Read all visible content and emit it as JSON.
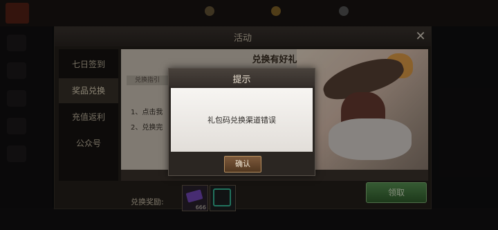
{
  "panel": {
    "title": "活动",
    "close_icon": "close-icon",
    "sidebar": [
      {
        "label": "七日签到",
        "active": false
      },
      {
        "label": "奖品兑换",
        "active": true
      },
      {
        "label": "充值返利",
        "active": false
      },
      {
        "label": "公众号",
        "active": false
      }
    ],
    "content": {
      "heading": "兑换有好礼",
      "guide_tab": "兑换指引",
      "steps": [
        "1、点击我",
        "2、兑换完"
      ]
    },
    "reward": {
      "label": "兑换奖励:",
      "items": [
        {
          "icon": "purple-gem-icon",
          "count": "666"
        },
        {
          "icon": "green-frame-icon",
          "count": ""
        }
      ],
      "claim_label": "领取"
    }
  },
  "dialog": {
    "title": "提示",
    "message": "礼包码兑换渠道错误",
    "confirm_label": "确认"
  },
  "colors": {
    "dialog_button": "#6b4b30",
    "claim_button": "#4a7f45",
    "panel_background": "#26211d"
  }
}
